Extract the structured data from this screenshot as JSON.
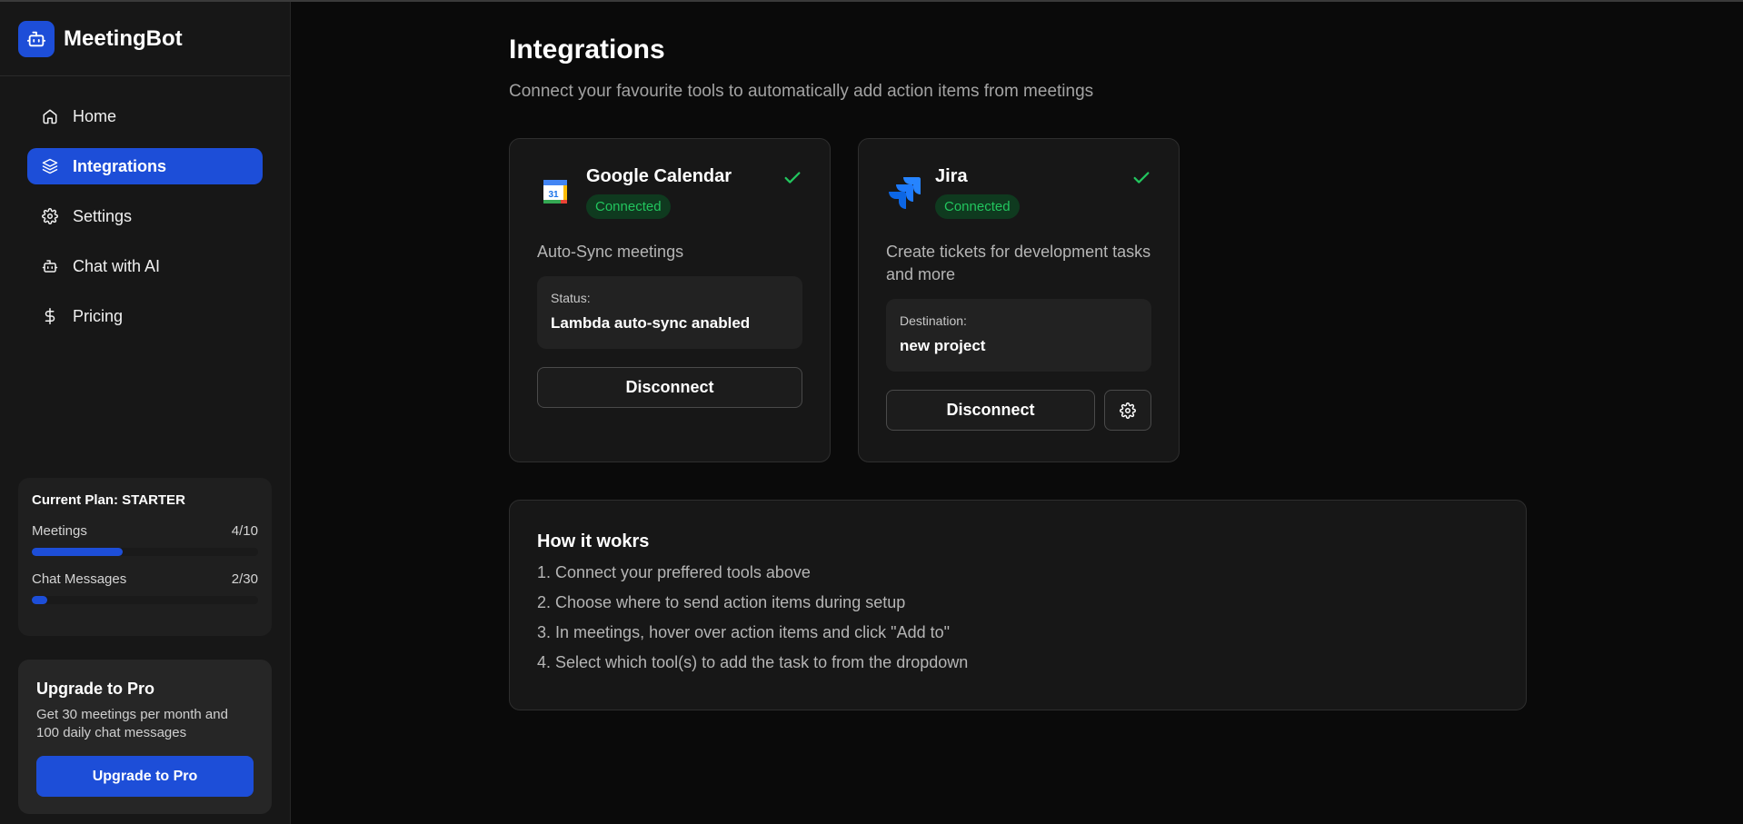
{
  "app": {
    "name": "MeetingBot"
  },
  "sidebar": {
    "items": [
      {
        "label": "Home",
        "icon": "home-icon",
        "active": false
      },
      {
        "label": "Integrations",
        "icon": "layers-icon",
        "active": true
      },
      {
        "label": "Settings",
        "icon": "gear-icon",
        "active": false
      },
      {
        "label": "Chat with AI",
        "icon": "bot-icon",
        "active": false
      },
      {
        "label": "Pricing",
        "icon": "dollar-icon",
        "active": false
      }
    ],
    "plan": {
      "title": "Current Plan: STARTER",
      "meetings_label": "Meetings",
      "meetings_value": "4/10",
      "meetings_fraction": 0.4,
      "chat_label": "Chat Messages",
      "chat_value": "2/30",
      "chat_fraction": 0.067
    },
    "upgrade": {
      "title": "Upgrade to Pro",
      "description": "Get 30 meetings per month and 100 daily chat messages",
      "button": "Upgrade to Pro"
    }
  },
  "main": {
    "title": "Integrations",
    "subtitle": "Connect your favourite tools to automatically add action items from meetings",
    "integrations": [
      {
        "name": "Google Calendar",
        "status": "Connected",
        "description": "Auto-Sync meetings",
        "info_label": "Status:",
        "info_value": "Lambda auto-sync anabled",
        "action": "Disconnect",
        "logo_text": "31"
      },
      {
        "name": "Jira",
        "status": "Connected",
        "description": "Create tickets for development tasks and more",
        "info_label": "Destination:",
        "info_value": "new project",
        "action": "Disconnect"
      }
    ],
    "how_it_works": {
      "title": "How it wokrs",
      "steps": [
        "1. Connect your preffered tools above",
        "2. Choose where to send action items during setup",
        "3. In meetings, hover over action items and click \"Add to\"",
        "4. Select which tool(s) to add the task to from the dropdown"
      ]
    }
  },
  "colors": {
    "accent": "#1d4ed8",
    "success": "#22c55e",
    "background": "#0a0a0a",
    "sidebar": "#171717"
  }
}
